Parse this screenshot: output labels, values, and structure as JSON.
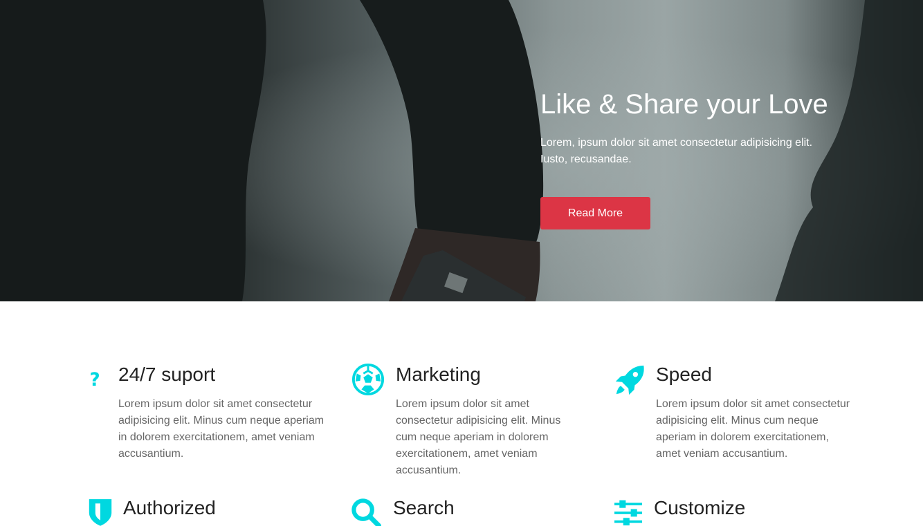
{
  "hero": {
    "title": "Like & Share your Love",
    "text": "Lorem, ipsum dolor sit amet consectetur adipisicing elit. Iusto, recusandae.",
    "button_label": "Read More"
  },
  "accent_color": "#00d8e0",
  "button_color": "#dc3545",
  "features": [
    {
      "icon": "question-icon",
      "title": "24/7 suport",
      "text": "Lorem ipsum dolor sit amet consectetur adipisicing elit. Minus cum neque aperiam in dolorem exercitationem, amet veniam accusantium."
    },
    {
      "icon": "soccer-ball-icon",
      "title": "Marketing",
      "text": "Lorem ipsum dolor sit amet consectetur adipisicing elit. Minus cum neque aperiam in dolorem exercitationem, amet veniam accusantium."
    },
    {
      "icon": "rocket-icon",
      "title": "Speed",
      "text": "Lorem ipsum dolor sit amet consectetur adipisicing elit. Minus cum neque aperiam in dolorem exercitationem, amet veniam accusantium."
    },
    {
      "icon": "shield-icon",
      "title": "Authorized"
    },
    {
      "icon": "search-icon",
      "title": "Search"
    },
    {
      "icon": "sliders-icon",
      "title": "Customize"
    }
  ]
}
